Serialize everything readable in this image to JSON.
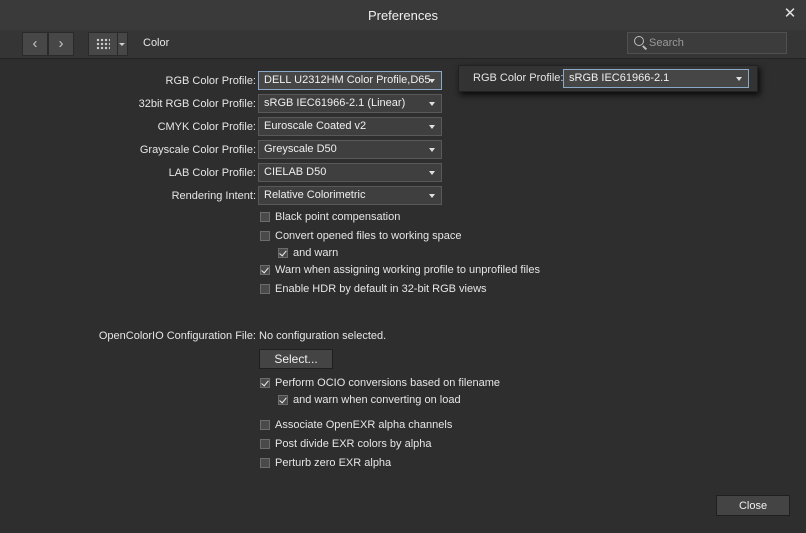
{
  "window": {
    "title": "Preferences"
  },
  "toolbar": {
    "section": "Color",
    "search_placeholder": "Search"
  },
  "profiles": [
    {
      "label": "RGB Color Profile:",
      "value": "DELL U2312HM Color Profile,D65"
    },
    {
      "label": "32bit RGB Color Profile:",
      "value": "sRGB IEC61966-2.1 (Linear)"
    },
    {
      "label": "CMYK Color Profile:",
      "value": "Euroscale Coated v2"
    },
    {
      "label": "Grayscale Color Profile:",
      "value": "Greyscale D50"
    },
    {
      "label": "LAB Color Profile:",
      "value": "CIELAB D50"
    },
    {
      "label": "Rendering Intent:",
      "value": "Relative Colorimetric"
    }
  ],
  "popup": {
    "label": "RGB Color Profile:",
    "value": "sRGB IEC61966-2.1"
  },
  "options": [
    {
      "label": "Black point compensation",
      "checked": false
    },
    {
      "label": "Convert opened files to working space",
      "checked": false
    },
    {
      "label": "and warn",
      "checked": true
    },
    {
      "label": "Warn when assigning working profile to unprofiled files",
      "checked": true
    },
    {
      "label": "Enable HDR by default in 32-bit RGB views",
      "checked": false
    }
  ],
  "ocio": {
    "label": "OpenColorIO Configuration File:",
    "value": "No configuration selected.",
    "select_button": "Select...",
    "options": [
      {
        "label": "Perform OCIO conversions based on filename",
        "checked": true
      },
      {
        "label": "and warn when converting on load",
        "checked": true
      },
      {
        "label": "Associate OpenEXR alpha channels",
        "checked": false
      },
      {
        "label": "Post divide EXR colors by alpha",
        "checked": false
      },
      {
        "label": "Perturb zero EXR alpha",
        "checked": false
      }
    ]
  },
  "footer": {
    "close_button": "Close"
  }
}
